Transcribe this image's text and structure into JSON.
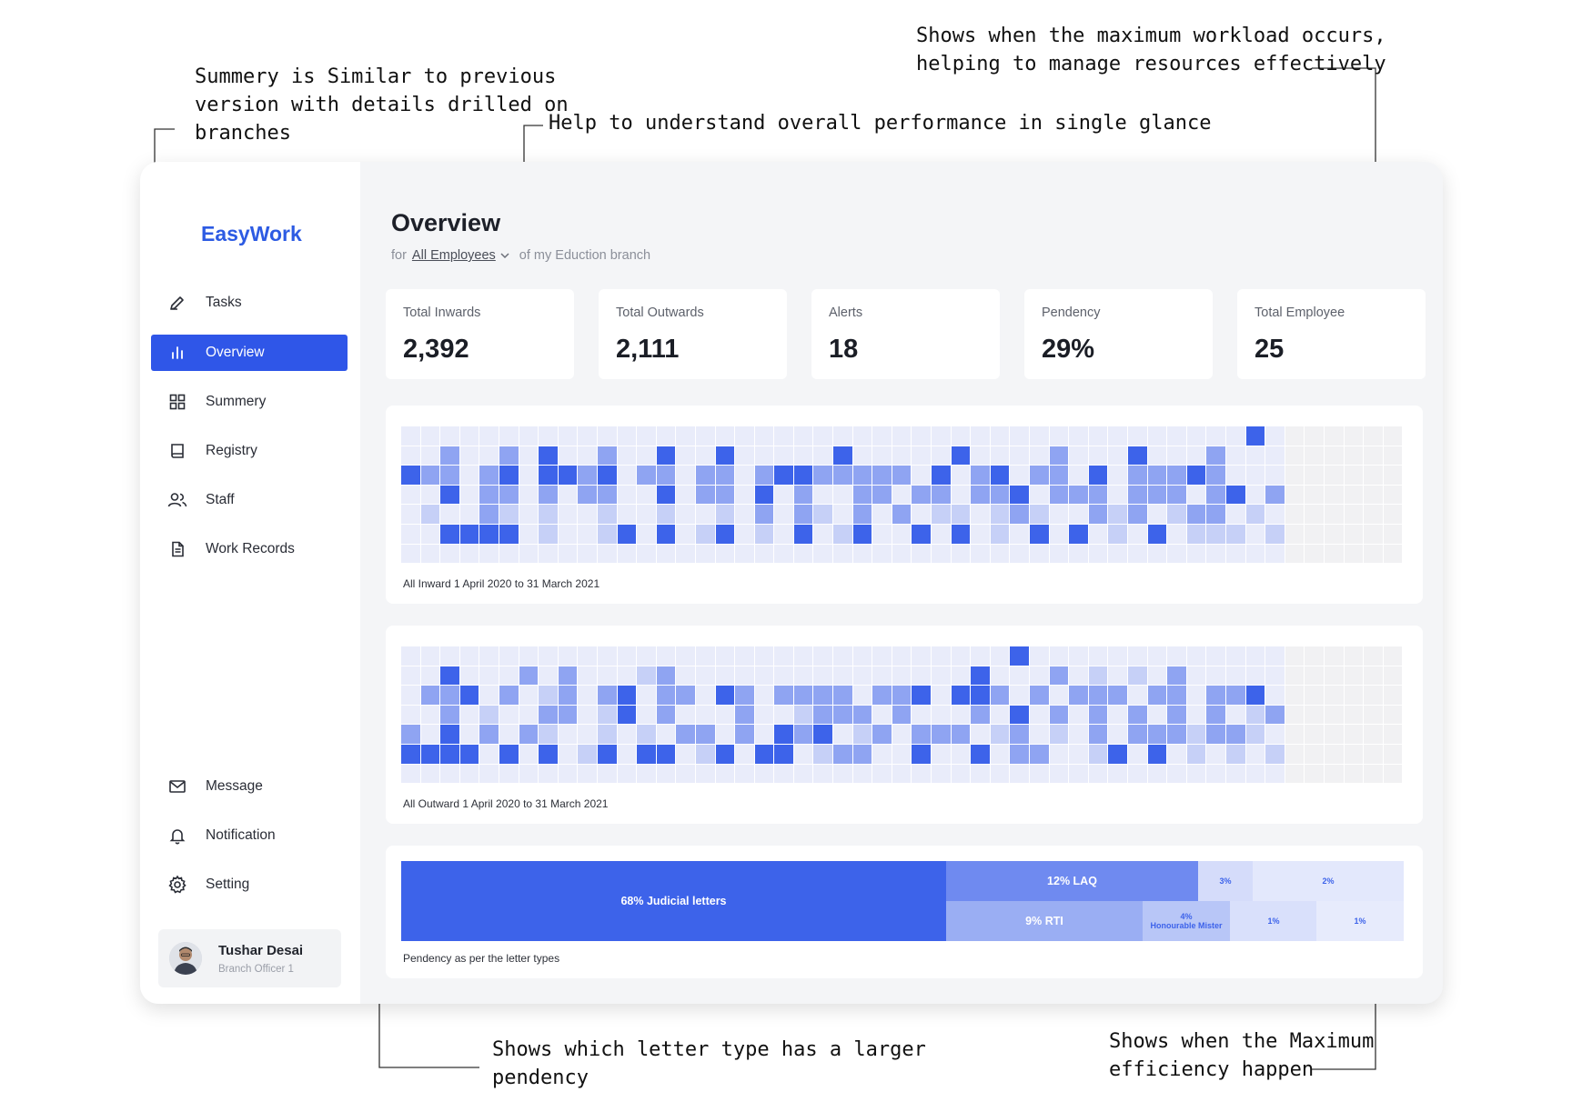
{
  "annotations": [
    {
      "id": "summary-note",
      "text": "Summery is Similar to previous\nversion with details drilled on\nbranches"
    },
    {
      "id": "overview-note",
      "text": "Help to understand overall performance in single glance"
    },
    {
      "id": "workload-note",
      "text": "Shows when the maximum workload occurs,\nhelping to manage resources effectively"
    },
    {
      "id": "pendency-note",
      "text": "Shows which letter type has a larger\npendency"
    },
    {
      "id": "efficiency-note",
      "text": "Shows when the Maximum\nefficiency happen"
    }
  ],
  "app": {
    "logo": "EasyWork"
  },
  "sidebar": {
    "items": [
      {
        "label": "Tasks",
        "icon": "pencil-icon",
        "active": false
      },
      {
        "label": "Overview",
        "icon": "bar-chart-icon",
        "active": true
      },
      {
        "label": "Summery",
        "icon": "grid-icon",
        "active": false
      },
      {
        "label": "Registry",
        "icon": "book-icon",
        "active": false
      },
      {
        "label": "Staff",
        "icon": "users-icon",
        "active": false
      },
      {
        "label": "Work Records",
        "icon": "document-icon",
        "active": false
      }
    ],
    "bottom_items": [
      {
        "label": "Message",
        "icon": "mail-icon"
      },
      {
        "label": "Notification",
        "icon": "bell-icon"
      },
      {
        "label": "Setting",
        "icon": "gear-icon"
      }
    ],
    "profile": {
      "name": "Tushar Desai",
      "role": "Branch Officer 1"
    }
  },
  "header": {
    "title": "Overview",
    "prefix": "for",
    "filter": "All Employees",
    "suffix": "of my Eduction branch"
  },
  "stats": [
    {
      "label": "Total Inwards",
      "value": "2,392"
    },
    {
      "label": "Total Outwards",
      "value": "2,111"
    },
    {
      "label": "Alerts",
      "value": "18"
    },
    {
      "label": "Pendency",
      "value": "29%"
    },
    {
      "label": "Total Employee",
      "value": "25"
    }
  ],
  "colors": {
    "accent": "#2f56e8",
    "level0": "#e9ecfa",
    "level1": "#c6d0f7",
    "level2": "#8fa4f2",
    "level3": "#3d63ea",
    "empty": "#f1f1f3"
  },
  "inward": {
    "caption": "All Inward 1 April 2020 to 31 March 2021",
    "active_weeks": 45,
    "levels": "0000000000000000000000000000000000000000000300000000000000000000000000\n0020020300200300300000300000300002000300020000000000000000000000000000\n3220230332302202202332222203023022030222320000000000000000000000000000\n0030220202200302203020022022022302220222023022020000000000000000000000\n0100210100100100102021020201101210021201220100000000000000000000000000\n0033330100130301301030130030301030301030111011000000000000000000000000\n0000000000000000000000000000000000000000000000000000000000000000000000"
  },
  "outward": {
    "caption": "All Outward 1 April 2020 to 31 March 2021",
    "active_weeks": 45,
    "levels": "0000000000000000000000000000000300000000000000000000000000000000000000\n0030002020001200000000000000030002010102000000000000000000000000000000\n0223020120230220320222202230332020222022022302000000000000000000000000\n0020100220130200020012220200020302020202020120000000000000000000000000\n2030202100101022020323012022201201020222122100000000000000000000000000\n3333030301303301303301220030030220013030101011000000000000000000000000\n0000000000000000000000000000000000000000000000000000000000000000000000"
  },
  "pendency": {
    "caption": "Pendency as per the letter types",
    "segments": [
      {
        "label": "68% Judicial letters",
        "pct": 68
      },
      {
        "label": "12%  LAQ",
        "pct": 12
      },
      {
        "label": "9%  RTI",
        "pct": 9
      },
      {
        "label": "4%",
        "sub": "Honourable Mister",
        "pct": 4
      },
      {
        "label": "3%",
        "pct": 3
      },
      {
        "label": "2%",
        "pct": 2
      },
      {
        "label": "1%",
        "pct": 1
      },
      {
        "label": "1%",
        "pct": 1
      }
    ]
  }
}
